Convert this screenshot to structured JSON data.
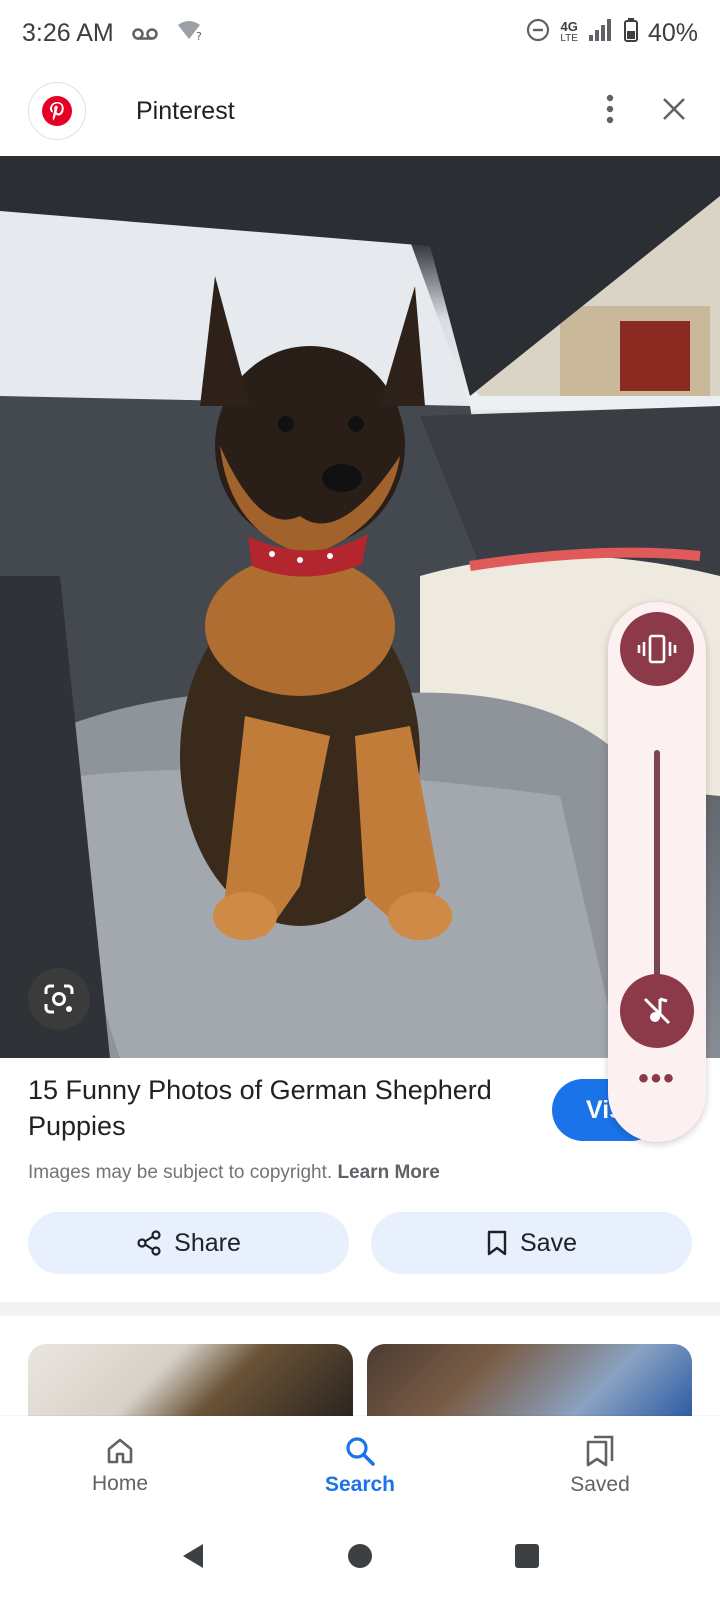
{
  "status_bar": {
    "time": "3:26 AM",
    "network_top": "4G",
    "network_bottom": "LTE",
    "battery": "40%"
  },
  "app_bar": {
    "site_name": "Pinterest"
  },
  "result": {
    "title": "15 Funny Photos of German Shepherd Puppies",
    "copyright_text": "Images may be subject to copyright.",
    "learn_more": "Learn More",
    "visit_label": "Vis"
  },
  "actions": {
    "share_label": "Share",
    "save_label": "Save"
  },
  "volume_panel": {
    "more_label": "•••",
    "level": 0
  },
  "bottom_nav": {
    "items": [
      {
        "label": "Home",
        "icon": "home-icon",
        "active": false
      },
      {
        "label": "Search",
        "icon": "search-icon",
        "active": true
      },
      {
        "label": "Saved",
        "icon": "saved-icon",
        "active": false
      }
    ]
  },
  "colors": {
    "accent": "#1a73e8",
    "pill_bg": "#e8f0fe",
    "volume_accent": "#8c3a4a",
    "pinterest_red": "#e60023"
  }
}
